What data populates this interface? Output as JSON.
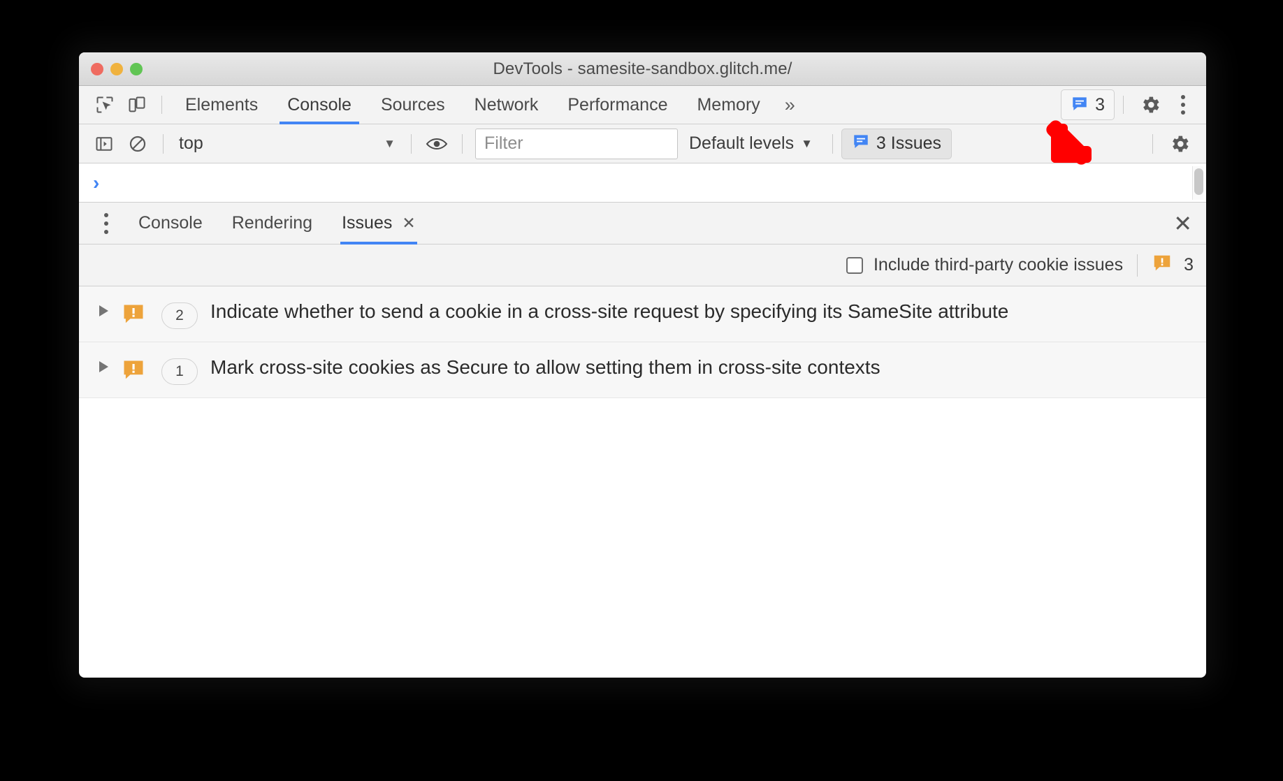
{
  "window": {
    "title": "DevTools - samesite-sandbox.glitch.me/",
    "traffic_lights": [
      "close",
      "minimize",
      "zoom"
    ]
  },
  "main_tabbar": {
    "left_icons": [
      {
        "name": "inspect-element-icon"
      },
      {
        "name": "device-toolbar-icon"
      }
    ],
    "tabs": [
      {
        "label": "Elements",
        "active": false
      },
      {
        "label": "Console",
        "active": true
      },
      {
        "label": "Sources",
        "active": false
      },
      {
        "label": "Network",
        "active": false
      },
      {
        "label": "Performance",
        "active": false
      },
      {
        "label": "Memory",
        "active": false
      }
    ],
    "more_tabs_label": "»",
    "issues_chip": {
      "icon": "issue-message-icon",
      "count": "3"
    },
    "settings_icon": "gear-icon",
    "menu_icon": "kebab-menu-icon"
  },
  "console_toolbar": {
    "sidebar_toggle_icon": "console-sidebar-icon",
    "clear_console_icon": "clear-console-icon",
    "context_value": "top",
    "context_caret": "▼",
    "live_expression_icon": "eye-icon",
    "filter_placeholder": "Filter",
    "filter_value": "",
    "levels_label": "Default levels",
    "levels_caret": "▼",
    "issues_button_label": "3 Issues",
    "issues_button_icon": "issue-message-icon",
    "settings_icon": "gear-icon"
  },
  "console_prompt": {
    "caret": "›"
  },
  "drawer": {
    "menu_icon": "kebab-menu-icon",
    "tabs": [
      {
        "label": "Console",
        "active": false,
        "closable": false
      },
      {
        "label": "Rendering",
        "active": false,
        "closable": false
      },
      {
        "label": "Issues",
        "active": true,
        "closable": true,
        "close_glyph": "✕"
      }
    ],
    "close_drawer_glyph": "✕"
  },
  "issues_options": {
    "third_party_label": "Include third-party cookie issues",
    "third_party_checked": false,
    "total_icon": "warning-bubble-icon",
    "total_count": "3"
  },
  "issues_list": [
    {
      "disclosure": "collapsed",
      "icon": "warning-bubble-icon",
      "count": "2",
      "title": "Indicate whether to send a cookie in a cross-site request by specifying its SameSite attribute"
    },
    {
      "disclosure": "collapsed",
      "icon": "warning-bubble-icon",
      "count": "1",
      "title": "Mark cross-site cookies as Secure to allow setting them in cross-site contexts"
    }
  ],
  "annotation": {
    "arrow": "red-arrow-down-left",
    "color": "#ff0000"
  },
  "colors": {
    "accent_blue": "#4285f4",
    "warning_orange": "#eda33b",
    "annotation_red": "#ff0000",
    "toolbar_bg": "#f3f3f3",
    "panel_bg": "#ffffff"
  }
}
